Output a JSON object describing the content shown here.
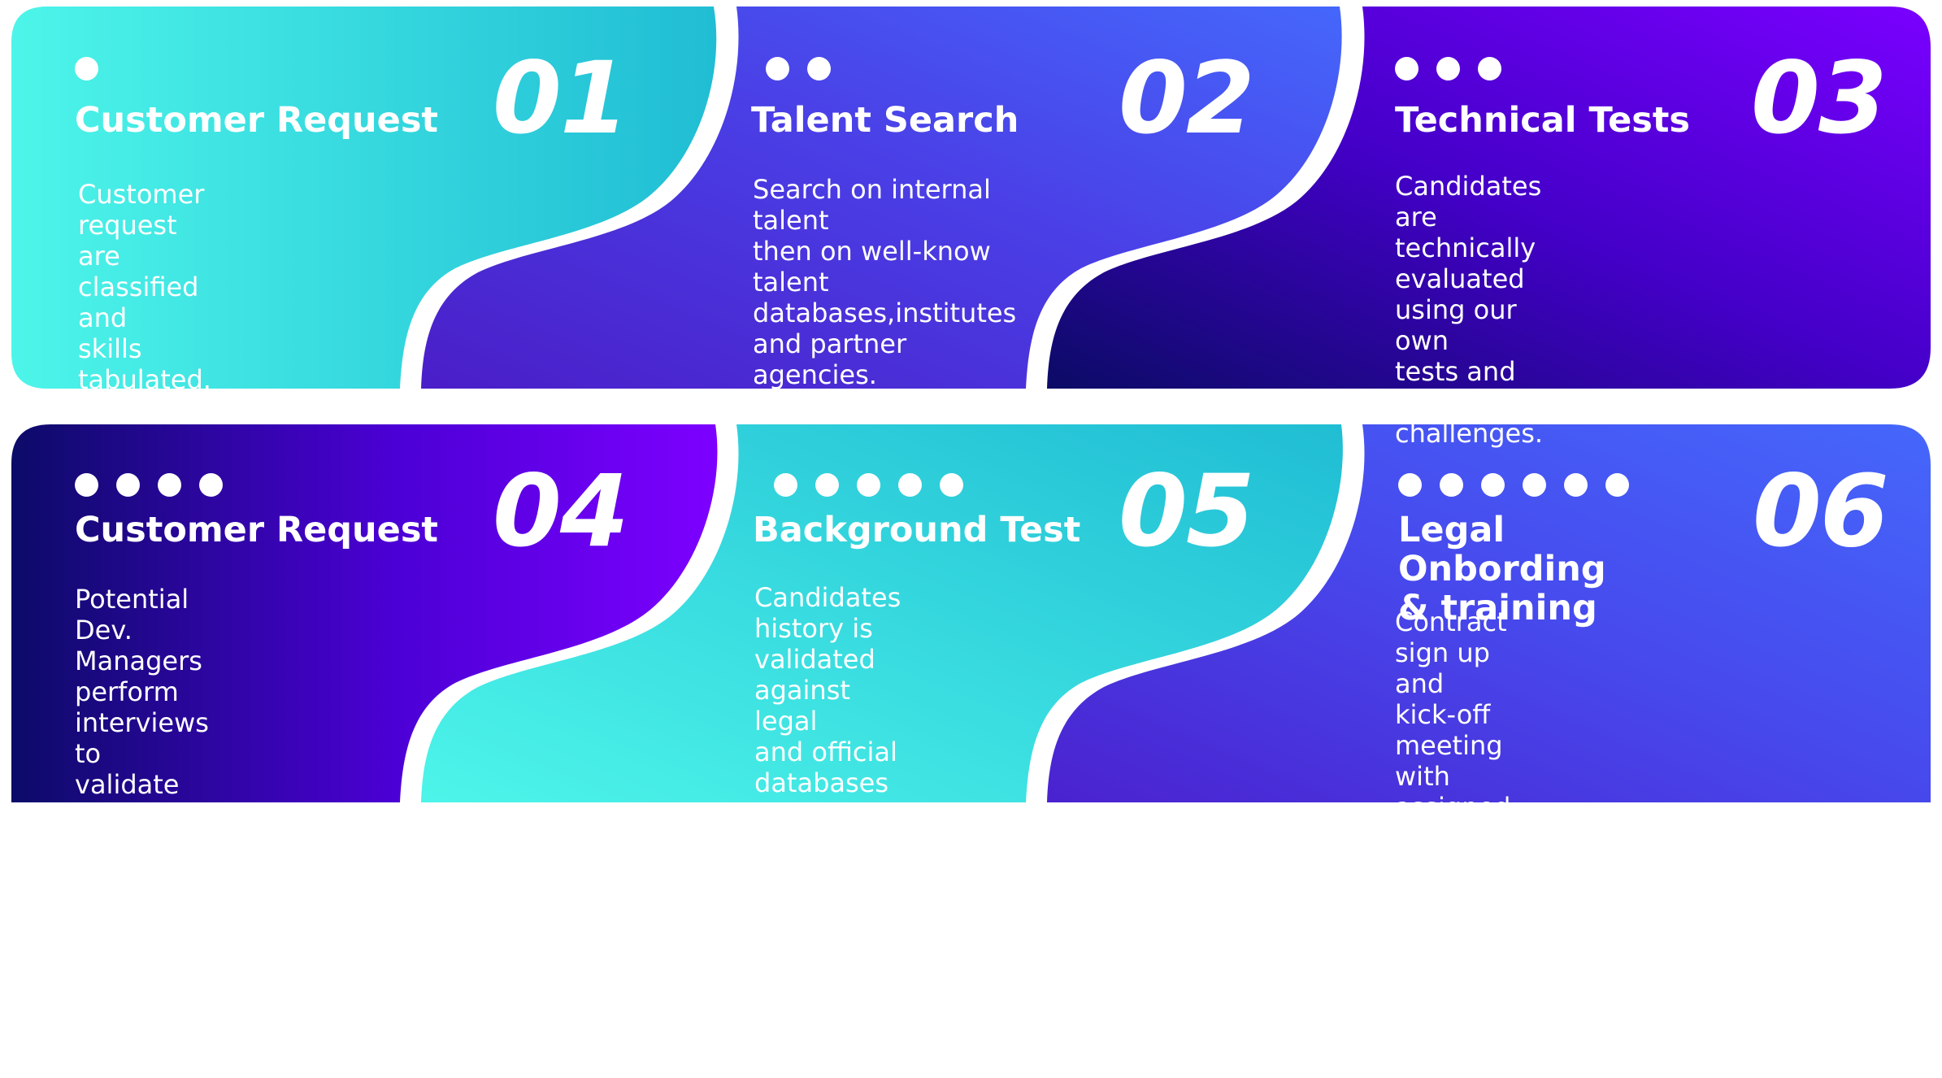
{
  "steps": [
    {
      "number": "01",
      "dots": 1,
      "title": "Customer Request",
      "description": "Customer request\nare classified and\nskills tabulated."
    },
    {
      "number": "02",
      "dots": 2,
      "title": "Talent Search",
      "description": "Search on internal talent\nthen on well-know talent\ndatabases,institutes\nand partner\nagencies."
    },
    {
      "number": "03",
      "dots": 3,
      "title": "Technical Tests",
      "description": "Candidates are technically\nevaluated using our own\ntests and coding challenges."
    },
    {
      "number": "04",
      "dots": 4,
      "title": "Customer Request",
      "description": "Potential Dev. Managers\nperform interviews to\nvalidate soft and technical\nskills, expertise and\nessential concepts\nfor each role."
    },
    {
      "number": "05",
      "dots": 5,
      "title": "Background Test",
      "description": "Candidates history is\nvalidated against legal\nand official databases\nand agencies."
    },
    {
      "number": "06",
      "dots": 6,
      "title": "Legal Onbording\n& training",
      "description": "Contract sign up and kick-off\nmeeting with assigned team or\nstarting the training plan."
    }
  ],
  "colors": {
    "cyan_light": "#4df5e9",
    "cyan": "#24c2d6",
    "blue": "#4361f8",
    "indigo": "#4a2fd8",
    "navy": "#0d0b6b",
    "violet": "#7a00ff",
    "white": "#ffffff"
  }
}
